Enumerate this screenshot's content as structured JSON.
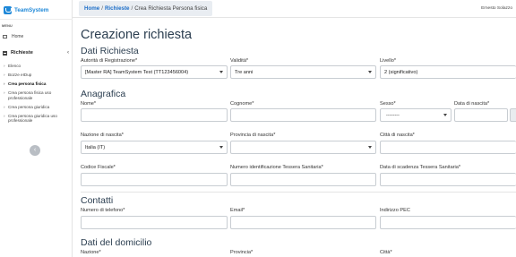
{
  "app": {
    "name": "TeamSystem"
  },
  "sidebar": {
    "menu_label": "MENU",
    "home_label": "Home",
    "section_label": "Richieste",
    "section_chevron": "‹",
    "items": [
      {
        "label": "Elenco"
      },
      {
        "label": "Bozze eIDup"
      },
      {
        "label": "Crea persona fisica"
      },
      {
        "label": "Crea persona fisica uso professionale"
      },
      {
        "label": "Crea persona giuridica"
      },
      {
        "label": "Crea persona giuridica uso professionale"
      }
    ],
    "collapse_glyph": "‹"
  },
  "header": {
    "breadcrumb": [
      "Home",
      "Richieste",
      "Crea Richiesta Persona fisica"
    ],
    "user": "Ernesto Solazzo"
  },
  "page": {
    "title": "Creazione richiesta"
  },
  "sections": {
    "dati": {
      "title": "Dati Richiesta",
      "autorita_label": "Autorità di Registrazione*",
      "autorita_value": "[Master RA] TeamSystem Test (TT123456004)",
      "validita_label": "Validità*",
      "validita_value": "Tre anni",
      "livello_label": "Livello*",
      "livello_value": "2 (significativo)"
    },
    "anagrafica": {
      "title": "Anagrafica",
      "nome_label": "Nome*",
      "cognome_label": "Cognome*",
      "sesso_label": "Sesso*",
      "sesso_value": "--------",
      "nascita_label": "Data di nascita*",
      "nazione_label": "Nazione di nascita*",
      "nazione_value": "Italia (IT)",
      "provincia_label": "Provincia di nascita*",
      "citta_label": "Città di nascita*",
      "cf_label": "Codice Fiscale*",
      "tessera_label": "Numero identificazione Tessera Sanitaria*",
      "scadenza_label": "Data di scadenza Tessera Sanitaria*"
    },
    "contatti": {
      "title": "Contatti",
      "telefono_label": "Numero di telefono*",
      "email_label": "Email*",
      "pec_label": "Indirizzo PEC"
    },
    "domicilio": {
      "title": "Dati del domicilio",
      "nazione_label": "Nazione*",
      "provincia_label": "Provincia*",
      "citta_label": "Città*"
    }
  }
}
